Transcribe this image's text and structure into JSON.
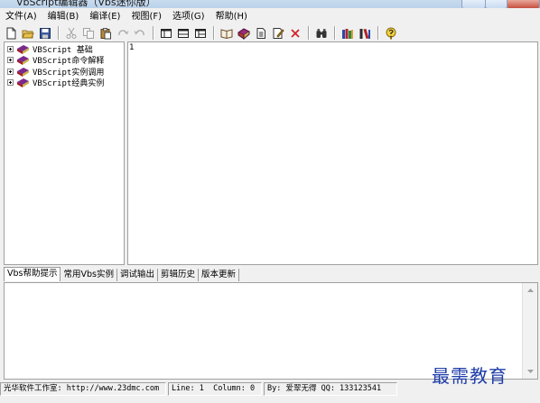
{
  "window": {
    "title": "VbScript编辑器（Vbs迷你版）"
  },
  "menu": [
    "文件(A)",
    "编辑(B)",
    "编译(E)",
    "视图(F)",
    "选项(G)",
    "帮助(H)"
  ],
  "toolbar": {
    "groups": [
      [
        "new-doc-icon",
        "open-folder-icon",
        "save-disk-icon"
      ],
      [
        "cut-icon",
        "copy-icon",
        "paste-icon",
        "redo-icon",
        "undo-icon"
      ],
      [
        "layout-left-icon",
        "layout-split-icon",
        "layout-bottom-icon"
      ],
      [
        "book-open-icon",
        "books-icon",
        "document-icon",
        "edit-document-icon",
        "close-x-icon"
      ],
      [
        "binoculars-icon"
      ],
      [
        "library-icon",
        "bookshelf-icon"
      ],
      [
        "help-question-icon"
      ]
    ],
    "disabled": [
      "cut-icon",
      "copy-icon",
      "redo-icon",
      "undo-icon"
    ]
  },
  "tree": {
    "items": [
      "VBScript 基础",
      "VBScript命令解释",
      "VBScript实例调用",
      "VBScript经典实例"
    ]
  },
  "editor": {
    "line_number": "1"
  },
  "bottom_tabs": [
    "Vbs帮助提示",
    "常用Vbs实例",
    "调试输出",
    "剪辑历史",
    "版本更新"
  ],
  "status": {
    "studio": "光华软件工作室: http://www.23dmc.com",
    "line": "Line: 1",
    "column": "Column: 0",
    "author": "By: 爱翠无得 QQ: 133123541"
  },
  "watermark": "最需教育",
  "colors": {
    "book_red": "#a0182c",
    "book_purple": "#7a2a8c",
    "watermark_blue": "#1f3da8"
  }
}
